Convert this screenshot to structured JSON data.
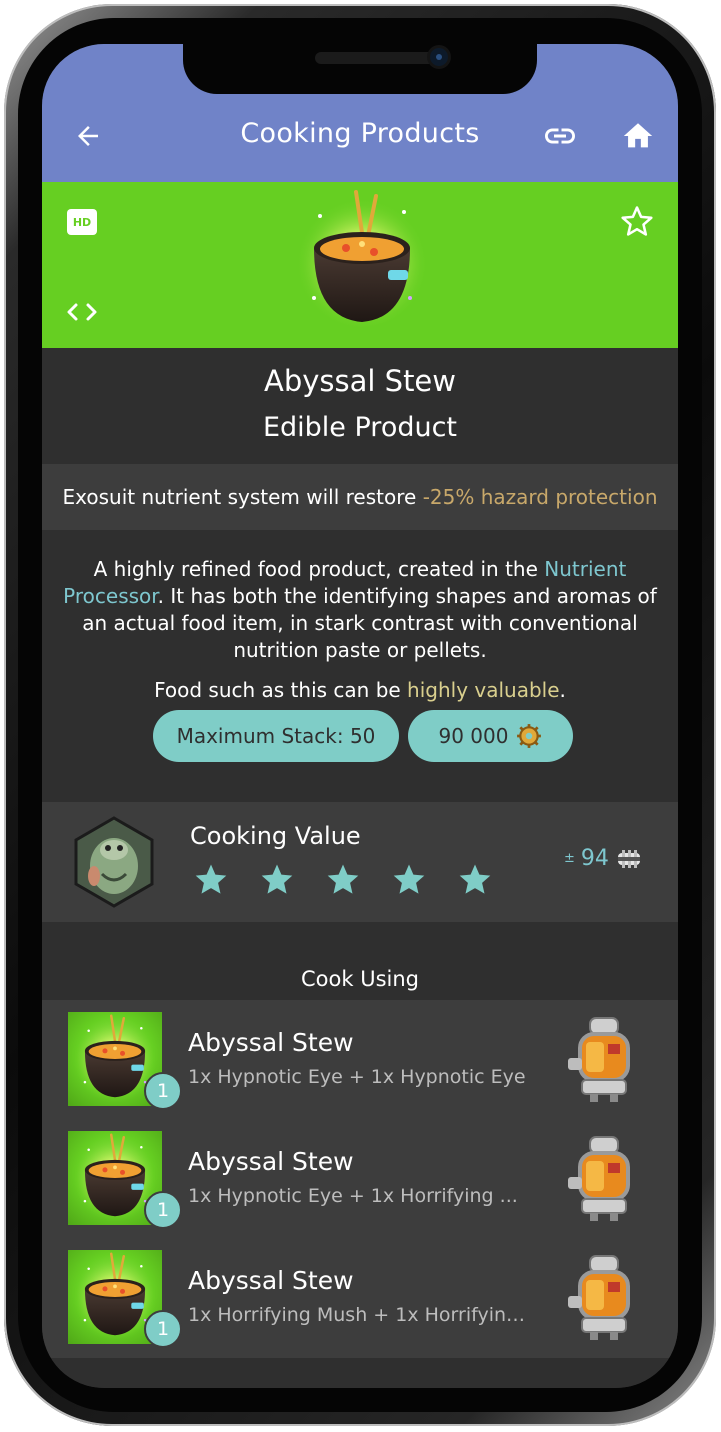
{
  "header": {
    "title": "Cooking Products",
    "back_icon": "arrow-left-icon",
    "link_icon": "link-icon",
    "home_icon": "home-icon",
    "color": "#7083c8"
  },
  "hero": {
    "hd_label": "HD",
    "background": "#66cf22"
  },
  "item": {
    "name": "Abyssal Stew",
    "type": "Edible Product"
  },
  "restore": {
    "prefix": "Exosuit nutrient system will restore ",
    "highlight": "-25% hazard protection"
  },
  "description": {
    "p1_before": "A highly refined food product, created in the ",
    "p1_link": "Nutrient Processor",
    "p1_after": ". It has both the identifying shapes and aromas of an actual food item, in stark contrast with conventional nutrition paste or pellets.",
    "p2_before": "Food such as this can be ",
    "p2_highlight": "highly valuable",
    "p2_after": "."
  },
  "stats": {
    "max_stack": "Maximum Stack: 50",
    "value": "90 000"
  },
  "cooking_value": {
    "label": "Cooking Value",
    "stars": 5,
    "pm": "±",
    "amount": "94"
  },
  "cook_using": {
    "heading": "Cook Using",
    "recipes": [
      {
        "name": "Abyssal Stew",
        "ingredients": "1x Hypnotic Eye + 1x Hypnotic Eye",
        "quantity": "1"
      },
      {
        "name": "Abyssal Stew",
        "ingredients": "1x Hypnotic Eye + 1x Horrifying ...",
        "quantity": "1"
      },
      {
        "name": "Abyssal Stew",
        "ingredients": "1x Horrifying Mush + 1x Horrifying...",
        "quantity": "1"
      }
    ]
  },
  "colors": {
    "accent": "#7fcdc7",
    "link": "#7ec7cf",
    "hazard": "#c8a86a",
    "valuable": "#d9cf8e"
  }
}
